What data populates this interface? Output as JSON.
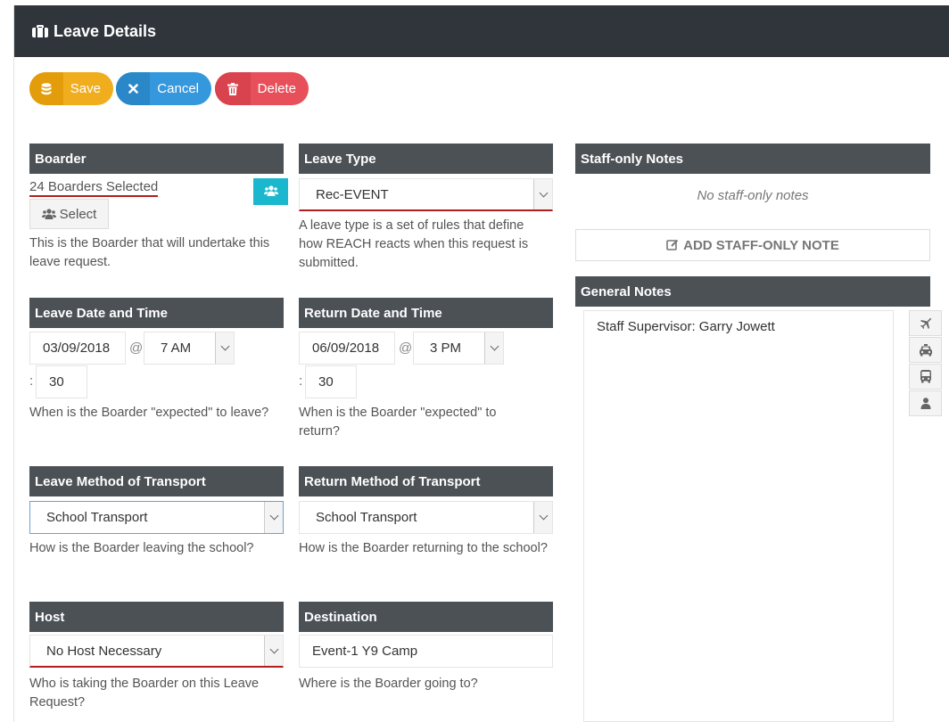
{
  "header": {
    "title": "Leave Details"
  },
  "toolbar": {
    "save_label": "Save",
    "cancel_label": "Cancel",
    "delete_label": "Delete"
  },
  "boarder": {
    "heading": "Boarder",
    "selected_text": "24 Boarders Selected",
    "select_label": "Select",
    "help": "This is the Boarder that will undertake this leave request."
  },
  "leave_type": {
    "heading": "Leave Type",
    "value": "Rec-EVENT",
    "help": "A leave type is a set of rules that define how REACH reacts when this request is submitted."
  },
  "staff_notes": {
    "heading": "Staff-only Notes",
    "empty_text": "No staff-only notes",
    "add_label": "ADD STAFF-ONLY NOTE"
  },
  "general_notes": {
    "heading": "General Notes",
    "text": "Staff Supervisor: Garry Jowett"
  },
  "leave_datetime": {
    "heading": "Leave Date and Time",
    "date": "03/09/2018",
    "at": "@",
    "hour": "7 AM",
    "colon": ":",
    "minute": "30",
    "help": "When is the Boarder \"expected\" to leave?"
  },
  "return_datetime": {
    "heading": "Return Date and Time",
    "date": "06/09/2018",
    "at": "@",
    "hour": "3 PM",
    "colon": ":",
    "minute": "30",
    "help": "When is the Boarder \"expected\" to return?"
  },
  "leave_transport": {
    "heading": "Leave Method of Transport",
    "value": "School Transport",
    "help": "How is the Boarder leaving the school?"
  },
  "return_transport": {
    "heading": "Return Method of Transport",
    "value": "School Transport",
    "help": "How is the Boarder returning to the school?"
  },
  "host": {
    "heading": "Host",
    "value": "No Host Necessary",
    "help": "Who is taking the Boarder on this Leave Request?"
  },
  "destination": {
    "heading": "Destination",
    "value": "Event-1 Y9 Camp",
    "help": "Where is the Boarder going to?"
  },
  "colors": {
    "header_bg": "#2f353b",
    "section_bg": "#4c5156",
    "save": "#f0ad1e",
    "cancel": "#3598dc",
    "delete": "#e7505a",
    "teal": "#1ab7cf",
    "required_underline": "#b21e1e"
  },
  "icons": {
    "header": "briefcase-icon",
    "save": "database-icon",
    "cancel": "close-icon",
    "delete": "trash-icon",
    "boarder_group": "users-icon",
    "add_note": "edit-icon",
    "side": [
      "plane-icon",
      "taxi-icon",
      "bus-icon",
      "person-icon"
    ]
  }
}
